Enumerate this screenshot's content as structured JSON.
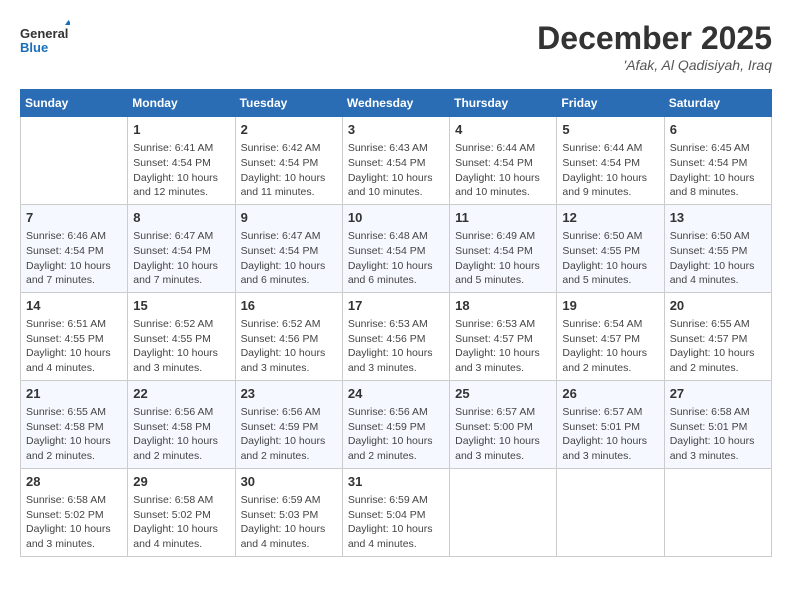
{
  "header": {
    "logo_line1": "General",
    "logo_line2": "Blue",
    "month": "December 2025",
    "location": "'Afak, Al Qadisiyah, Iraq"
  },
  "weekdays": [
    "Sunday",
    "Monday",
    "Tuesday",
    "Wednesday",
    "Thursday",
    "Friday",
    "Saturday"
  ],
  "weeks": [
    [
      {
        "day": "",
        "info": ""
      },
      {
        "day": "1",
        "info": "Sunrise: 6:41 AM\nSunset: 4:54 PM\nDaylight: 10 hours\nand 12 minutes."
      },
      {
        "day": "2",
        "info": "Sunrise: 6:42 AM\nSunset: 4:54 PM\nDaylight: 10 hours\nand 11 minutes."
      },
      {
        "day": "3",
        "info": "Sunrise: 6:43 AM\nSunset: 4:54 PM\nDaylight: 10 hours\nand 10 minutes."
      },
      {
        "day": "4",
        "info": "Sunrise: 6:44 AM\nSunset: 4:54 PM\nDaylight: 10 hours\nand 10 minutes."
      },
      {
        "day": "5",
        "info": "Sunrise: 6:44 AM\nSunset: 4:54 PM\nDaylight: 10 hours\nand 9 minutes."
      },
      {
        "day": "6",
        "info": "Sunrise: 6:45 AM\nSunset: 4:54 PM\nDaylight: 10 hours\nand 8 minutes."
      }
    ],
    [
      {
        "day": "7",
        "info": "Sunrise: 6:46 AM\nSunset: 4:54 PM\nDaylight: 10 hours\nand 7 minutes."
      },
      {
        "day": "8",
        "info": "Sunrise: 6:47 AM\nSunset: 4:54 PM\nDaylight: 10 hours\nand 7 minutes."
      },
      {
        "day": "9",
        "info": "Sunrise: 6:47 AM\nSunset: 4:54 PM\nDaylight: 10 hours\nand 6 minutes."
      },
      {
        "day": "10",
        "info": "Sunrise: 6:48 AM\nSunset: 4:54 PM\nDaylight: 10 hours\nand 6 minutes."
      },
      {
        "day": "11",
        "info": "Sunrise: 6:49 AM\nSunset: 4:54 PM\nDaylight: 10 hours\nand 5 minutes."
      },
      {
        "day": "12",
        "info": "Sunrise: 6:50 AM\nSunset: 4:55 PM\nDaylight: 10 hours\nand 5 minutes."
      },
      {
        "day": "13",
        "info": "Sunrise: 6:50 AM\nSunset: 4:55 PM\nDaylight: 10 hours\nand 4 minutes."
      }
    ],
    [
      {
        "day": "14",
        "info": "Sunrise: 6:51 AM\nSunset: 4:55 PM\nDaylight: 10 hours\nand 4 minutes."
      },
      {
        "day": "15",
        "info": "Sunrise: 6:52 AM\nSunset: 4:55 PM\nDaylight: 10 hours\nand 3 minutes."
      },
      {
        "day": "16",
        "info": "Sunrise: 6:52 AM\nSunset: 4:56 PM\nDaylight: 10 hours\nand 3 minutes."
      },
      {
        "day": "17",
        "info": "Sunrise: 6:53 AM\nSunset: 4:56 PM\nDaylight: 10 hours\nand 3 minutes."
      },
      {
        "day": "18",
        "info": "Sunrise: 6:53 AM\nSunset: 4:57 PM\nDaylight: 10 hours\nand 3 minutes."
      },
      {
        "day": "19",
        "info": "Sunrise: 6:54 AM\nSunset: 4:57 PM\nDaylight: 10 hours\nand 2 minutes."
      },
      {
        "day": "20",
        "info": "Sunrise: 6:55 AM\nSunset: 4:57 PM\nDaylight: 10 hours\nand 2 minutes."
      }
    ],
    [
      {
        "day": "21",
        "info": "Sunrise: 6:55 AM\nSunset: 4:58 PM\nDaylight: 10 hours\nand 2 minutes."
      },
      {
        "day": "22",
        "info": "Sunrise: 6:56 AM\nSunset: 4:58 PM\nDaylight: 10 hours\nand 2 minutes."
      },
      {
        "day": "23",
        "info": "Sunrise: 6:56 AM\nSunset: 4:59 PM\nDaylight: 10 hours\nand 2 minutes."
      },
      {
        "day": "24",
        "info": "Sunrise: 6:56 AM\nSunset: 4:59 PM\nDaylight: 10 hours\nand 2 minutes."
      },
      {
        "day": "25",
        "info": "Sunrise: 6:57 AM\nSunset: 5:00 PM\nDaylight: 10 hours\nand 3 minutes."
      },
      {
        "day": "26",
        "info": "Sunrise: 6:57 AM\nSunset: 5:01 PM\nDaylight: 10 hours\nand 3 minutes."
      },
      {
        "day": "27",
        "info": "Sunrise: 6:58 AM\nSunset: 5:01 PM\nDaylight: 10 hours\nand 3 minutes."
      }
    ],
    [
      {
        "day": "28",
        "info": "Sunrise: 6:58 AM\nSunset: 5:02 PM\nDaylight: 10 hours\nand 3 minutes."
      },
      {
        "day": "29",
        "info": "Sunrise: 6:58 AM\nSunset: 5:02 PM\nDaylight: 10 hours\nand 4 minutes."
      },
      {
        "day": "30",
        "info": "Sunrise: 6:59 AM\nSunset: 5:03 PM\nDaylight: 10 hours\nand 4 minutes."
      },
      {
        "day": "31",
        "info": "Sunrise: 6:59 AM\nSunset: 5:04 PM\nDaylight: 10 hours\nand 4 minutes."
      },
      {
        "day": "",
        "info": ""
      },
      {
        "day": "",
        "info": ""
      },
      {
        "day": "",
        "info": ""
      }
    ]
  ]
}
